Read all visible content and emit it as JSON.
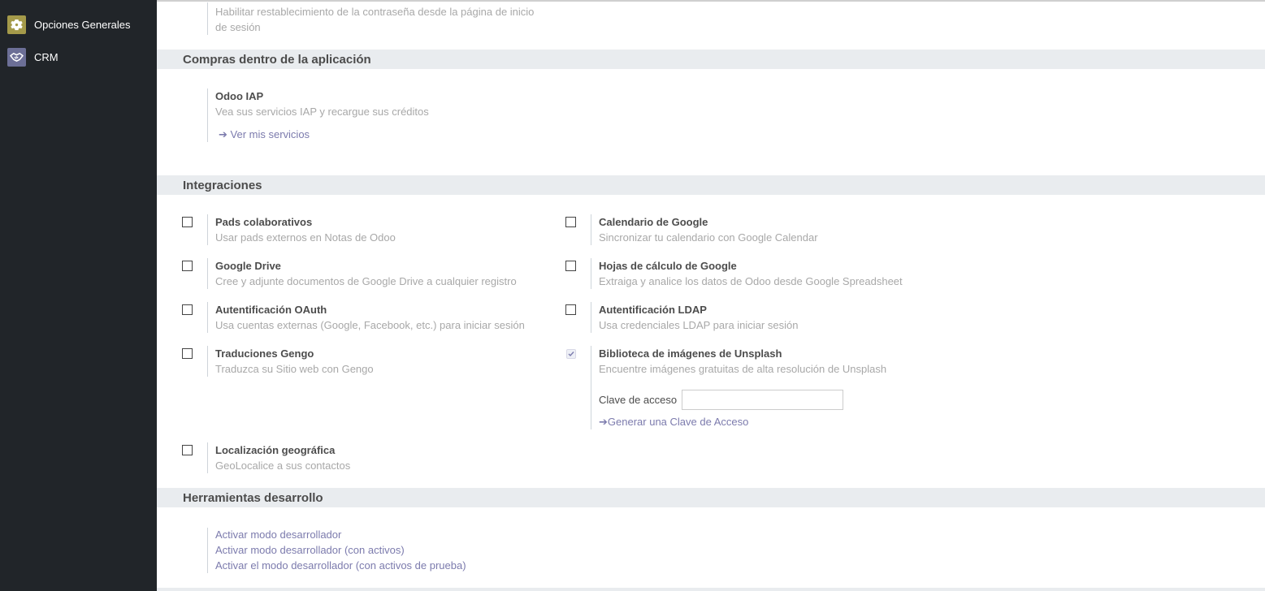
{
  "sidebar": {
    "items": [
      {
        "label": "Opciones Generales",
        "icon": "gear-icon",
        "icon_bg": "#a49a4a"
      },
      {
        "label": "CRM",
        "icon": "handshake-icon",
        "icon_bg": "#6c6f96"
      }
    ]
  },
  "top_setting": {
    "description_line1": "Habilitar restablecimiento de la contraseña desde la página de inicio",
    "description_line2": "de sesión"
  },
  "sections": {
    "iap": {
      "title": "Compras dentro de la aplicación",
      "setting_title": "Odoo IAP",
      "setting_desc": "Vea sus servicios IAP y recargue sus créditos",
      "link": "Ver mis servicios"
    },
    "integrations": {
      "title": "Integraciones",
      "items": [
        {
          "title": "Pads colaborativos",
          "desc": "Usar pads externos en Notas de Odoo",
          "checked": false
        },
        {
          "title": "Calendario de Google",
          "desc": "Sincronizar tu calendario con Google Calendar",
          "checked": false
        },
        {
          "title": "Google Drive",
          "desc": "Cree y adjunte documentos de Google Drive a cualquier registro",
          "checked": false
        },
        {
          "title": "Hojas de cálculo de Google",
          "desc": "Extraiga y analice los datos de Odoo desde Google Spreadsheet",
          "checked": false
        },
        {
          "title": "Autentificación OAuth",
          "desc": "Usa cuentas externas (Google, Facebook, etc.) para iniciar sesión",
          "checked": false
        },
        {
          "title": "Autentificación LDAP",
          "desc": "Usa credenciales LDAP para iniciar sesión",
          "checked": false
        },
        {
          "title": "Traduciones Gengo",
          "desc": "Traduzca su Sitio web con Gengo",
          "checked": false
        },
        {
          "title": "Biblioteca de imágenes de Unsplash",
          "desc": "Encuentre imágenes gratuitas de alta resolución de Unsplash",
          "checked": true
        },
        {
          "title": "Localización geográfica",
          "desc": "GeoLocalice a sus contactos",
          "checked": false
        }
      ],
      "unsplash": {
        "access_key_label": "Clave de acceso",
        "access_key_value": "",
        "generate_link": "Generar una Clave de Acceso"
      }
    },
    "devtools": {
      "title": "Herramientas desarrollo",
      "links": [
        "Activar modo desarrollador",
        "Activar modo desarrollador (con activos)",
        "Activar el modo desarrollador (con activos de prueba)"
      ]
    }
  },
  "colors": {
    "sidebar_bg": "#212529",
    "section_bg": "#e9ecef",
    "link": "#7c7bad",
    "muted": "#a8a8a8"
  }
}
